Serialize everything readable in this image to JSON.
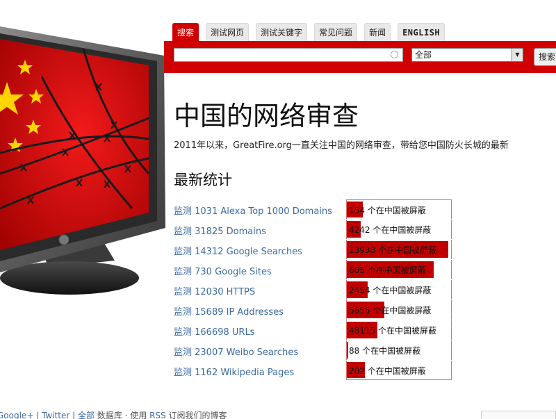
{
  "tabs": [
    {
      "label": "搜索",
      "active": true
    },
    {
      "label": "测试网页",
      "active": false
    },
    {
      "label": "测试关键字",
      "active": false
    },
    {
      "label": "常见问题",
      "active": false
    },
    {
      "label": "新闻",
      "active": false
    },
    {
      "label": "ENGLISH",
      "active": false
    }
  ],
  "search": {
    "value": "",
    "scope_selected": "全部",
    "button_label": "搜索"
  },
  "page_title": "中国的网络审查",
  "intro": "2011年以来，GreatFire.org一直关注中国的网络审查，带给您中国防火长城的最新",
  "stats": {
    "title": "最新统计",
    "rows": [
      {
        "label": "监测 1031 Alexa Top 1000 Domains",
        "text": "154 个在中国被屏蔽",
        "percent": 15
      },
      {
        "label": "监测 31825 Domains",
        "text": "4242 个在中国被屏蔽",
        "percent": 13
      },
      {
        "label": "监测 14312 Google Searches",
        "text": "13938 个在中国被屏蔽",
        "percent": 97
      },
      {
        "label": "监测 730 Google Sites",
        "text": "605 个在中国被屏蔽",
        "percent": 83
      },
      {
        "label": "监测 12030 HTTPS",
        "text": "2454 个在中国被屏蔽",
        "percent": 20
      },
      {
        "label": "监测 15689 IP Addresses",
        "text": "5655 个在中国被屏蔽",
        "percent": 36
      },
      {
        "label": "监测 166698 URLs",
        "text": "48115 个在中国被屏蔽",
        "percent": 29
      },
      {
        "label": "监测 23007 Weibo Searches",
        "text": "88 个在中国被屏蔽",
        "percent": 1
      },
      {
        "label": "监测 1162 Wikipedia Pages",
        "text": "202 个在中国被屏蔽",
        "percent": 17
      }
    ]
  },
  "footer": {
    "link_1": "Google+",
    "link_2": "Twitter",
    "link_3": "全部",
    "text_1": "数据库 · 使用",
    "link_4": "RSS",
    "text_2": "订阅我们的博客"
  },
  "colors": {
    "brand_red": "#d10000",
    "bar_red": "#c00000",
    "link_blue": "#3b6aa3"
  },
  "icons": {
    "hero": "tv-with-china-flag-and-barbed-wire",
    "clear": "clear-circle-icon",
    "dropdown": "chevron-down-icon"
  }
}
